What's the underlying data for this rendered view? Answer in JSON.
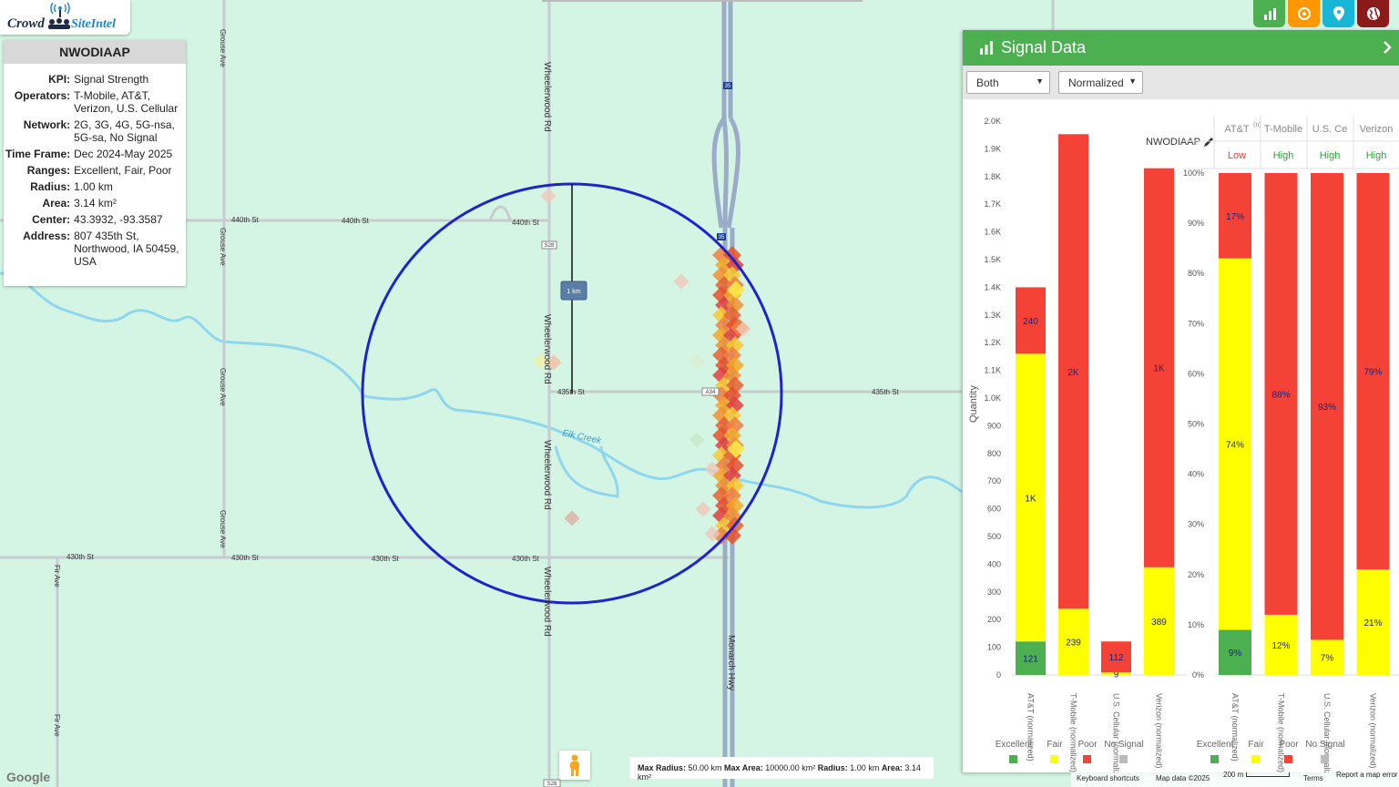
{
  "logo": {
    "word1": "Crowd",
    "word2": "SiteIntel"
  },
  "info": {
    "title": "NWODIAAP",
    "rows": [
      {
        "k": "KPI:",
        "v": "Signal Strength"
      },
      {
        "k": "Operators:",
        "v": "T-Mobile, AT&T, Verizon, U.S. Cellular"
      },
      {
        "k": "Network:",
        "v": "2G, 3G, 4G, 5G-nsa, 5G-sa, No Signal"
      },
      {
        "k": "Time Frame:",
        "v": "Dec 2024-May 2025"
      },
      {
        "k": "Ranges:",
        "v": "Excellent, Fair, Poor"
      },
      {
        "k": "Radius:",
        "v": "1.00 km"
      },
      {
        "k": "Area:",
        "v": "3.14 km²"
      },
      {
        "k": "Center:",
        "v": "43.3932, -93.3587"
      },
      {
        "k": "Address:",
        "v": "807 435th St, Northwood, IA 50459, USA"
      }
    ]
  },
  "map_labels": {
    "roads": [
      "440th St",
      "440th St",
      "440th St",
      "435th St",
      "435th St",
      "430th St",
      "430th St",
      "430th St",
      "430th St",
      "Wheelerwood Rd",
      "Wheelerwood Rd",
      "Wheelerwood Rd",
      "Wheelerwood Rd",
      "Grouse Ave",
      "Grouse Ave",
      "Grouse Ave",
      "Grouse Ave",
      "Fir Ave",
      "Fir Ave",
      "Monarch Hwy"
    ],
    "creek": "Elk Creek",
    "shields": [
      "35",
      "35",
      "S28",
      "A34",
      "S28"
    ],
    "radius_tag": "1 km"
  },
  "bottom": {
    "note_parts": [
      "Max Radius:",
      " 50.00 km ",
      "Max Area:",
      " 10000.00 km² ",
      "Radius:",
      " 1.00 km ",
      "Area:",
      " 3.14 km²"
    ],
    "attribution": [
      "Keyboard shortcuts",
      "Map data ©2025",
      "200 m",
      "Terms",
      "Report a map error"
    ],
    "google": "Google"
  },
  "panel": {
    "title": "Signal Data",
    "filter": "Both",
    "mode": "Normalized",
    "chart_title": "NWODIAAP",
    "operators_header": [
      {
        "name": "AT&T",
        "sup": "(n)",
        "level": "Low"
      },
      {
        "name": "T-Mobile",
        "sup": "",
        "level": "High"
      },
      {
        "name": "U.S. Ce",
        "sup": "",
        "level": "High"
      },
      {
        "name": "Verizon",
        "sup": "",
        "level": "High"
      }
    ],
    "legend": [
      "Excellent",
      "Fair",
      "Poor",
      "No Signal"
    ]
  },
  "colors": {
    "excellent": "#4caf50",
    "fair": "#ffff00",
    "poor": "#f44336",
    "nosignal": "#bbbbbb",
    "high": "#2e9e3a",
    "low": "#e53935",
    "accent": "#4caf50"
  },
  "chart_data": [
    {
      "type": "bar",
      "stacked": true,
      "ylabel": "Quantity",
      "ylim": [
        0,
        2000
      ],
      "yticks": [
        "0",
        "100",
        "200",
        "300",
        "400",
        "500",
        "600",
        "700",
        "800",
        "900",
        "1.0K",
        "1.1K",
        "1.2K",
        "1.3K",
        "1.4K",
        "1.5K",
        "1.6K",
        "1.7K",
        "1.8K",
        "1.9K",
        "2.0K"
      ],
      "categories": [
        "AT&T (normalized)",
        "T-Mobile (normalized)",
        "U.S. Cellular (normalized)",
        "Verizon (normalized)"
      ],
      "series": [
        {
          "name": "Excellent",
          "values": [
            121,
            0,
            0,
            0
          ],
          "labels": [
            "121",
            "",
            "",
            ""
          ]
        },
        {
          "name": "Fair",
          "values": [
            1039,
            239,
            9,
            389
          ],
          "labels": [
            "1K",
            "239",
            "9",
            "389"
          ]
        },
        {
          "name": "Poor",
          "values": [
            240,
            1714,
            112,
            1441
          ],
          "labels": [
            "240",
            "2K",
            "112",
            "1K"
          ]
        },
        {
          "name": "No Signal",
          "values": [
            0,
            0,
            0,
            0
          ],
          "labels": [
            "",
            "",
            "",
            ""
          ]
        }
      ]
    },
    {
      "type": "bar",
      "stacked": true,
      "ylim": [
        0,
        100
      ],
      "yticks": [
        "0%",
        "10%",
        "20%",
        "30%",
        "40%",
        "50%",
        "60%",
        "70%",
        "80%",
        "90%",
        "100%"
      ],
      "categories": [
        "AT&T (normalized)",
        "T-Mobile (normalized)",
        "U.S. Cellular (normalized)",
        "Verizon (normalized)"
      ],
      "series": [
        {
          "name": "Excellent",
          "values": [
            9,
            0,
            0,
            0
          ],
          "labels": [
            "9%",
            "",
            "",
            ""
          ]
        },
        {
          "name": "Fair",
          "values": [
            74,
            12,
            7,
            21
          ],
          "labels": [
            "74%",
            "12%",
            "7%",
            "21%"
          ]
        },
        {
          "name": "Poor",
          "values": [
            17,
            88,
            93,
            79
          ],
          "labels": [
            "17%",
            "88%",
            "93%",
            "79%"
          ]
        },
        {
          "name": "No Signal",
          "values": [
            0,
            0,
            0,
            0
          ],
          "labels": [
            "",
            "",
            "",
            ""
          ]
        }
      ]
    }
  ]
}
